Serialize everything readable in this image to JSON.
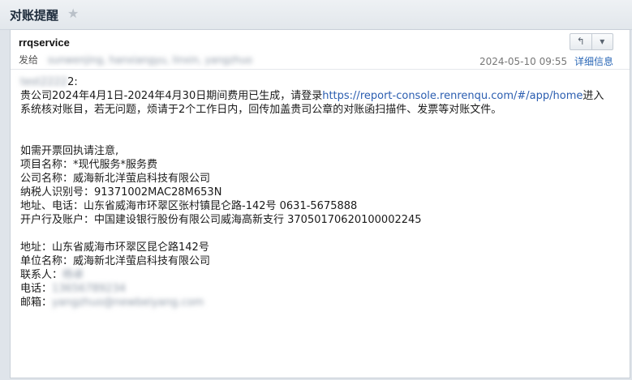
{
  "header": {
    "subject": "对账提醒",
    "star_icon": "star-icon"
  },
  "message": {
    "sender": "rrqservice",
    "to_label": "发给",
    "to_recipients": "sunwenjing, hanxiangyu, linxin, yangzhuo",
    "date": "2024-05-10 09:55",
    "detail_link": "详细信息",
    "nav_icons": [
      "reply-icon",
      "chevron-down-icon"
    ]
  },
  "body": {
    "greeting_name": "test2222",
    "greeting_suffix": "2:",
    "para1_text": "贵公司2024年4月1日-2024年4月30日期间费用已生成，请登录",
    "para1_link": "https://report-console.renrenqu.com/#/app/home",
    "para1_rest": "进入系统核对账目，若无问题，烦请于2个工作日内，回传加盖贵司公章的对账函扫描件、发票等对账文件。",
    "invoice_lines": [
      "如需开票回执请注意,",
      "项目名称：*现代服务*服务费",
      "公司名称：威海新北洋萤启科技有限公司",
      "纳税人识别号：91371002MAC28M653N",
      "地址、电话：山东省威海市环翠区张村镇昆仑路-142号 0631-5675888",
      "开户行及账户：中国建设银行股份有限公司威海高新支行 37050170620100002245"
    ],
    "address_line": "地址：山东省威海市环翠区昆仑路142号",
    "unit_line": "单位名称：威海新北洋萤启科技有限公司",
    "contact_label": "联系人：",
    "contact_value": "杨卓",
    "phone_label": "电话：",
    "phone_value": "13656789234",
    "email_label": "邮箱：",
    "email_value": "yangzhuo@newbeiyang.com"
  }
}
